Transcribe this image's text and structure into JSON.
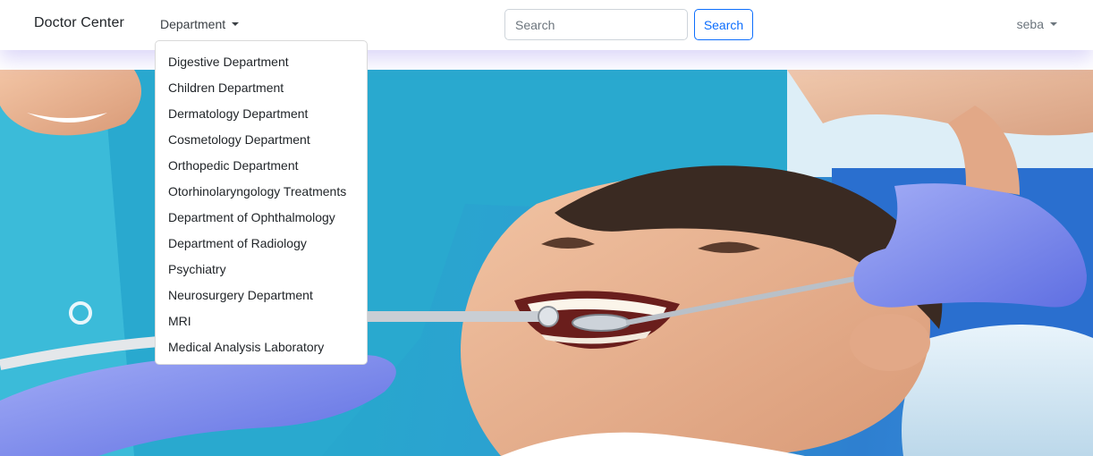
{
  "navbar": {
    "brand": "Doctor Center",
    "department_label": "Department",
    "search": {
      "placeholder": "Search",
      "button_label": "Search"
    },
    "user_label": "seba"
  },
  "department_menu": {
    "items": [
      {
        "label": "Digestive Department"
      },
      {
        "label": "Children Department"
      },
      {
        "label": "Dermatology Department"
      },
      {
        "label": "Cosmetology Department"
      },
      {
        "label": "Orthopedic Department"
      },
      {
        "label": "Otorhinolaryngology Treatments"
      },
      {
        "label": "Department of Ophthalmology"
      },
      {
        "label": "Department of Radiology"
      },
      {
        "label": "Psychiatry"
      },
      {
        "label": "Neurosurgery Department"
      },
      {
        "label": "MRI"
      },
      {
        "label": "Medical Analysis Laboratory"
      }
    ]
  },
  "colors": {
    "primary": "#0d6efd",
    "scrub_teal": "#2aa8cd",
    "glove_purple": "#7f8df0"
  }
}
